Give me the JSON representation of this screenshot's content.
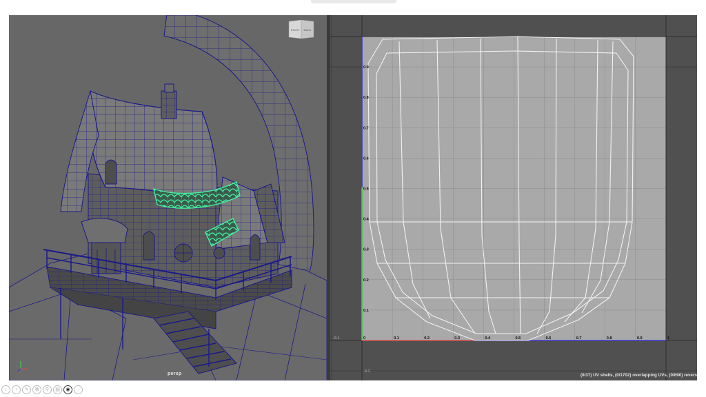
{
  "viewport": {
    "camera_label": "persp",
    "viewcube": {
      "face_left": "RIGHT",
      "face_right": "BACK"
    }
  },
  "uv_editor": {
    "status_text": "(0/37) UV shells, (0/1702) overlapping UVs, (0/690) revers",
    "x_ticks": [
      "-0.1",
      "0",
      "0.1",
      "0.2",
      "0.3",
      "0.4",
      "0.5",
      "0.6",
      "0.7",
      "0.8",
      "0.9",
      "1"
    ],
    "y_ticks": [
      "0.9",
      "0.8",
      "0.7",
      "0.6",
      "0.5",
      "0.4",
      "0.3",
      "0.2",
      "0.1",
      "-0.1"
    ],
    "uv_tile_color": "#a9a9a9",
    "uv_edge_color": "#f2f2f2",
    "u_axis_color": "#d84a4a",
    "v_axis_color": "#3dcf4e",
    "border_axis_color": "#3b3bd4"
  },
  "mesh": {
    "wire_color": "#1a1a8a",
    "selected_color": "#43f0a4"
  },
  "toolbar": {
    "buttons": [
      {
        "name": "back",
        "icon": "previous-arrow-icon"
      },
      {
        "name": "forward",
        "icon": "next-arrow-icon"
      },
      {
        "name": "pen",
        "icon": "pen-icon"
      },
      {
        "name": "copy",
        "icon": "copy-icon"
      },
      {
        "name": "zoom",
        "icon": "zoom-icon"
      },
      {
        "name": "slides",
        "icon": "slides-icon"
      },
      {
        "name": "camera",
        "icon": "camera-icon"
      },
      {
        "name": "more",
        "icon": "more-icon"
      }
    ]
  }
}
